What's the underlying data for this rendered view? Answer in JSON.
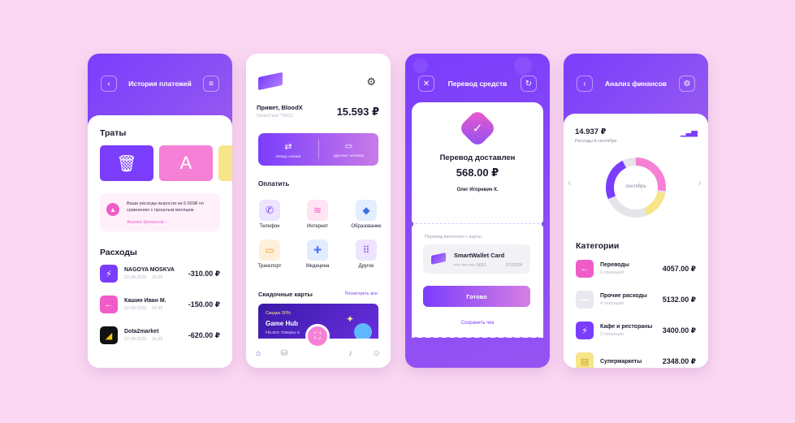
{
  "history": {
    "title": "История платежей",
    "spending_title": "Траты",
    "alert_text": "Ваши расходы выросли на 5.693₽ по сравнению с прошлым месяцем.",
    "alert_link": "Анализ финансов ›",
    "expenses_title": "Расходы",
    "rows": [
      {
        "name": "NAGOYA MOSKVA",
        "date": "22.09.2022",
        "time": "16:35",
        "amount": "-310.00 ₽",
        "color": "#7b3dfc"
      },
      {
        "name": "Кашин Иван М.",
        "date": "22.09.2022",
        "time": "16:35",
        "amount": "-150.00 ₽",
        "color": "#f15bc8"
      },
      {
        "name": "Dota2market",
        "date": "22.09.2022",
        "time": "16:35",
        "amount": "-620.00 ₽",
        "color": "#111111"
      }
    ]
  },
  "home": {
    "greeting": "Привет, BloodX",
    "card_sub": "SmartCard **0612",
    "balance": "15.593 ₽",
    "action_left": "Между своими",
    "action_right": "Другому человеку",
    "pay_title": "Оплатить",
    "tiles": [
      {
        "label": "Телефон",
        "glyph": "✆",
        "bg": "#ede4ff",
        "fg": "#7b3dfc"
      },
      {
        "label": "Интернет",
        "glyph": "≋",
        "bg": "#ffe4f4",
        "fg": "#f15bc8"
      },
      {
        "label": "Образование",
        "glyph": "◆",
        "bg": "#e3eeff",
        "fg": "#3a73e8"
      },
      {
        "label": "Транспорт",
        "glyph": "▭",
        "bg": "#fff0dc",
        "fg": "#f29a2e"
      },
      {
        "label": "Медицина",
        "glyph": "✚",
        "bg": "#e1ecff",
        "fg": "#4a7ef0"
      },
      {
        "label": "Другое",
        "glyph": "⠿",
        "bg": "#ede4ff",
        "fg": "#7b3dfc"
      }
    ],
    "discount_title": "Скидочные карты",
    "see_all": "Посмотреть все",
    "promo_discount": "Скидка 30%",
    "promo_name": "Game Hub",
    "promo_sub": "На все товары и"
  },
  "transfer": {
    "title": "Перевод средств",
    "delivered": "Перевод доставлен",
    "amount": "568.00 ₽",
    "recipient": "Олег Игоревич К.",
    "via_label": "Перевод выполнен с карты:",
    "card_name": "SmartWallet Card",
    "card_num": "•••• •••• •••• 5681",
    "card_exp": "07/2024",
    "done_button": "Готово",
    "save_receipt": "Сохранить чек"
  },
  "analysis": {
    "title": "Анализ финансов",
    "total": "14.937 ₽",
    "total_sub": "Расходы в сентябре",
    "donut_label": "сентябрь",
    "categories_title": "Категории",
    "categories": [
      {
        "name": "Переводы",
        "ops": "9 операций",
        "amount": "4057.00 ₽",
        "color": "#f15bc8",
        "glyph": "←"
      },
      {
        "name": "Прочие расходы",
        "ops": "4 операции",
        "amount": "5132.00 ₽",
        "color": "#e4e4ea",
        "glyph": "•••"
      },
      {
        "name": "Кафе и рестораны",
        "ops": "3 операции",
        "amount": "3400.00 ₽",
        "color": "#7b3dfc",
        "glyph": "⚡"
      },
      {
        "name": "Супермаркеты",
        "ops": "",
        "amount": "2348.00 ₽",
        "color": "#f6e58a",
        "glyph": "▤"
      }
    ]
  }
}
